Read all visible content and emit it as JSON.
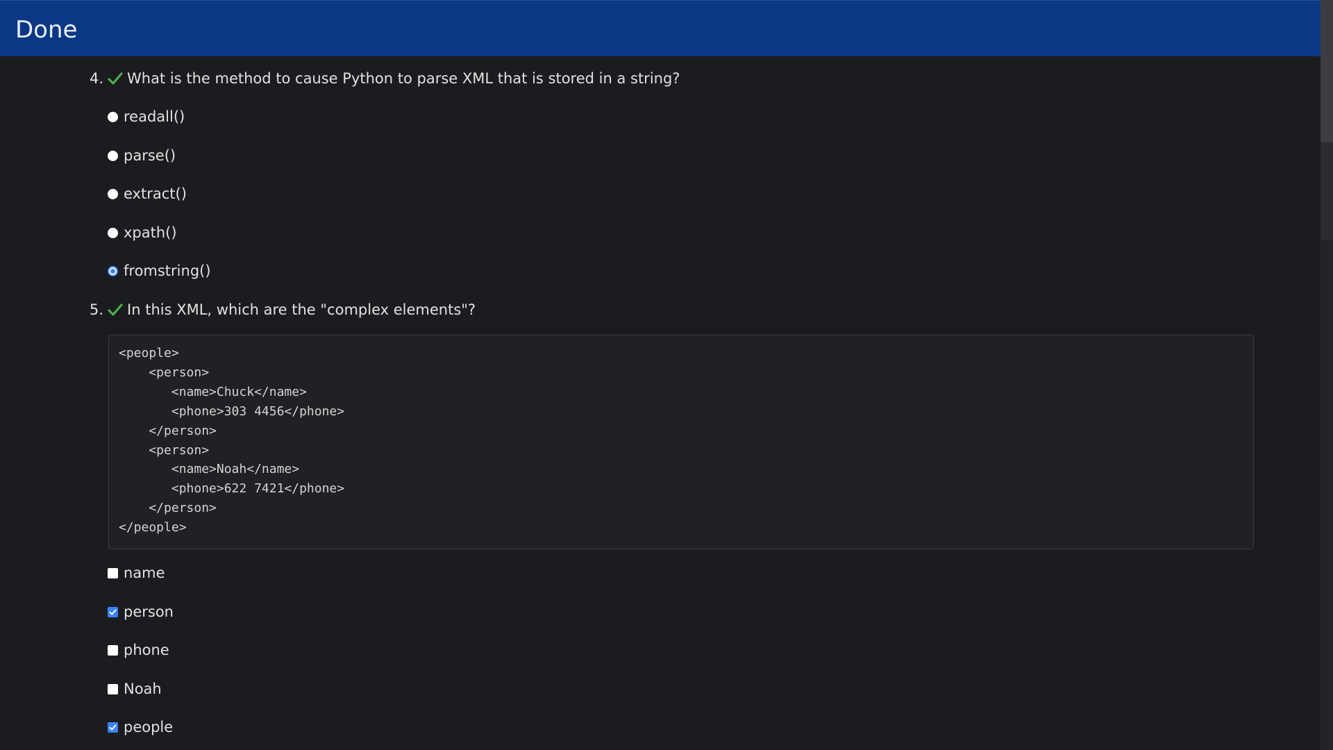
{
  "header": {
    "title": "Done"
  },
  "questions": [
    {
      "number": "4.",
      "text": "What is the method to cause Python to parse XML that is stored in a string?",
      "type": "radio",
      "options": [
        {
          "label": "readall()",
          "selected": false
        },
        {
          "label": "parse()",
          "selected": false
        },
        {
          "label": "extract()",
          "selected": false
        },
        {
          "label": "xpath()",
          "selected": false
        },
        {
          "label": "fromstring()",
          "selected": true
        }
      ]
    },
    {
      "number": "5.",
      "text": "In this XML, which are the \"complex elements\"?",
      "type": "checkbox",
      "code": "<people>\n    <person>\n       <name>Chuck</name>\n       <phone>303 4456</phone>\n    </person>\n    <person>\n       <name>Noah</name>\n       <phone>622 7421</phone>\n    </person>\n</people>",
      "options": [
        {
          "label": "name",
          "selected": false
        },
        {
          "label": "person",
          "selected": true
        },
        {
          "label": "phone",
          "selected": false
        },
        {
          "label": "Noah",
          "selected": false
        },
        {
          "label": "people",
          "selected": true
        }
      ]
    }
  ],
  "colors": {
    "header_bg": "#0b3885",
    "page_bg": "#1b1c1f",
    "accent": "#3b82f6",
    "correct_check": "#4caf50"
  }
}
